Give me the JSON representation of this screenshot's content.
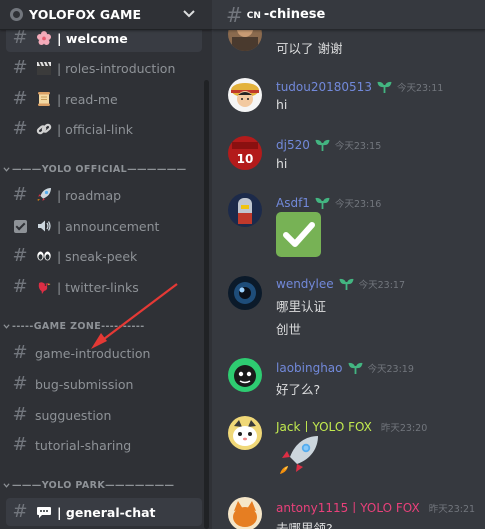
{
  "server": {
    "name": "YOLOFOX GAME"
  },
  "channels": [
    {
      "name": "| welcome",
      "icon": "cherry-blossom-icon",
      "selected": true
    },
    {
      "name": "| roles-introduction",
      "icon": "clapper-board-icon"
    },
    {
      "name": "| read-me",
      "icon": "scroll-icon"
    },
    {
      "name": "| official-link",
      "icon": "link-icon"
    },
    {
      "name": "| roadmap",
      "icon": "rocket-icon"
    },
    {
      "name": "| announcement",
      "icon": "speaker-icon"
    },
    {
      "name": "| sneak-peek",
      "icon": "eyes-icon"
    },
    {
      "name": "| twitter-links",
      "icon": "bird-icon"
    },
    {
      "name": "game-introduction"
    },
    {
      "name": "bug-submission"
    },
    {
      "name": "sugguestion"
    },
    {
      "name": "tutorial-sharing"
    },
    {
      "name": "| general-chat",
      "icon": "speech-balloon-icon",
      "selected": true
    }
  ],
  "categories": [
    {
      "name": "———YOLO OFFICIAL——————"
    },
    {
      "name": "-----GAME ZONE----------"
    },
    {
      "name": "———YOLO PARK———————"
    }
  ],
  "chat": {
    "channel_tag": "CN",
    "channel_name": "-chinese",
    "messages": [
      {
        "author": "",
        "time": "",
        "lines": [
          "可以了 谢谢"
        ]
      },
      {
        "author": "tudou20180513",
        "time": "今天23:11",
        "lines": [
          "hi"
        ],
        "author_color": "#7289da"
      },
      {
        "author": "dj520",
        "time": "今天23:15",
        "lines": [
          "hi"
        ],
        "author_color": "#7289da"
      },
      {
        "author": "Asdf1",
        "time": "今天23:16",
        "lines": [],
        "author_color": "#7289da",
        "emoji": "white-check-mark-icon"
      },
      {
        "author": "wendylee",
        "time": "今天23:17",
        "lines": [
          "哪里认证",
          "创世"
        ],
        "author_color": "#7289da"
      },
      {
        "author": "laobinghao",
        "time": "今天23:19",
        "lines": [
          "好了么?"
        ],
        "author_color": "#7289da"
      },
      {
        "author": "Jack丨YOLO FOX",
        "time": "昨天23:20",
        "lines": [],
        "author_color": "#c2ea4f",
        "emoji": "rocket-icon"
      },
      {
        "author": "antony1115丨YOLO FOX",
        "time": "昨天23:21",
        "lines": [
          "去哪里领?"
        ],
        "author_color": "#e9407a"
      }
    ]
  },
  "colors": {
    "sidebar_bg": "#2f3136",
    "chat_bg": "#36393f",
    "mention_blue": "#7289da",
    "arrow_red": "#e53935"
  }
}
